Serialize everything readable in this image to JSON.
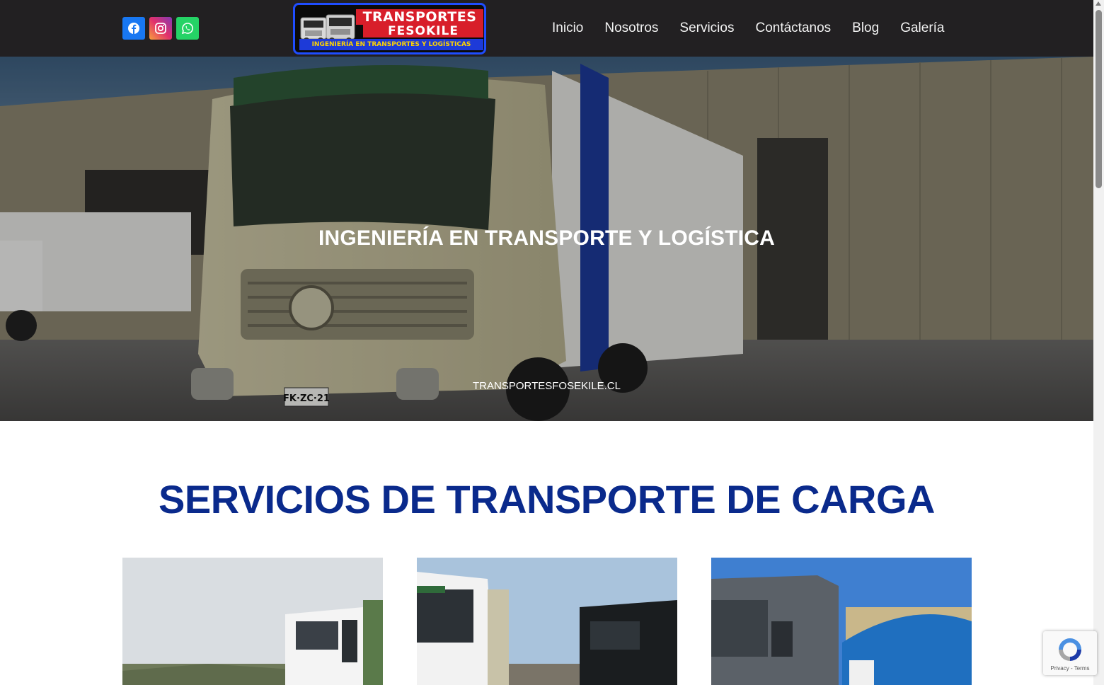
{
  "header": {
    "social": [
      {
        "name": "facebook-icon",
        "color": "#1877f2"
      },
      {
        "name": "instagram-icon",
        "color": "#e1306c"
      },
      {
        "name": "whatsapp-icon",
        "color": "#25d366"
      }
    ],
    "logo": {
      "line1": "TRANSPORTES",
      "line2": "FESOKILE",
      "line3": "INGENIERÍA EN TRANSPORTES Y LOGÍSTICAS"
    },
    "nav": [
      "Inicio",
      "Nosotros",
      "Servicios",
      "Contáctanos",
      "Blog",
      "Galería"
    ]
  },
  "hero": {
    "title": "INGENIERÍA EN TRANSPORTE Y LOGÍSTICA",
    "subtitle": "TRANSPORTESFOSEKILE.CL",
    "truck_plate": "FK·ZC·21"
  },
  "section": {
    "title_light": "SERVICIOS DE ",
    "title_bold": "TRANSPORTE DE CARGA"
  },
  "recaptcha": {
    "links": "Privacy - Terms"
  },
  "colors": {
    "header_bg": "#222022",
    "section_title": "#0a2a8c",
    "logo_red": "#d81e2a",
    "logo_blue": "#1d3ad8"
  }
}
